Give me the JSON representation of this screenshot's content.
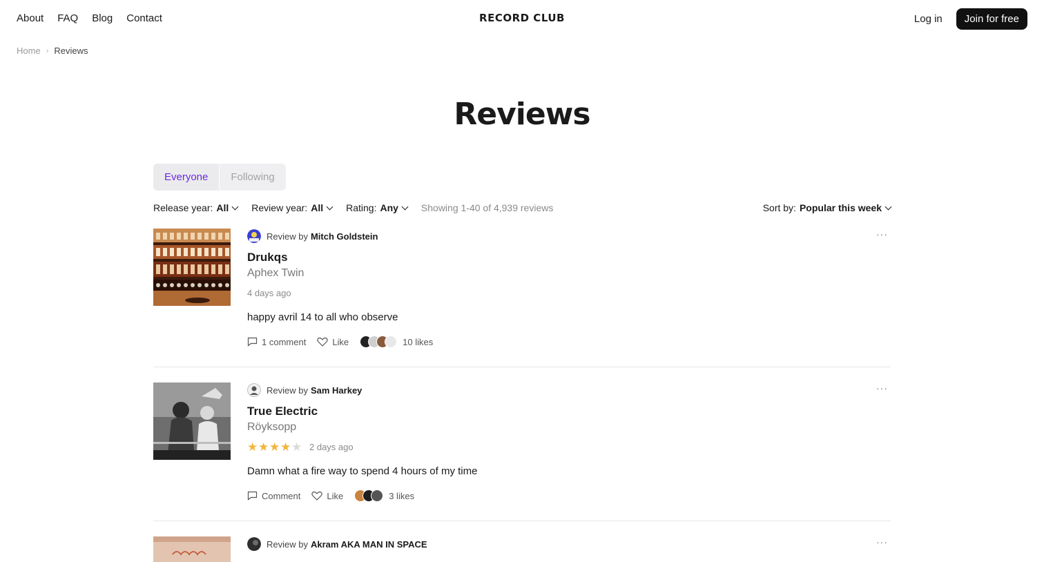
{
  "nav": {
    "links": [
      "About",
      "FAQ",
      "Blog",
      "Contact"
    ],
    "logo": "RECORD CLUB",
    "login": "Log in",
    "join": "Join for free"
  },
  "breadcrumb": {
    "home": "Home",
    "current": "Reviews",
    "separator": "›"
  },
  "page": {
    "title": "Reviews"
  },
  "tabs": {
    "everyone": "Everyone",
    "following": "Following"
  },
  "filters": {
    "release_year": {
      "label": "Release year:",
      "value": "All"
    },
    "review_year": {
      "label": "Review year:",
      "value": "All"
    },
    "rating": {
      "label": "Rating:",
      "value": "Any"
    },
    "showing": "Showing 1-40 of 4,939 reviews"
  },
  "sort": {
    "label": "Sort by:",
    "value": "Popular this week"
  },
  "reviews": [
    {
      "prefix": "Review by",
      "user": "Mitch Goldstein",
      "album": "Drukqs",
      "artist": "Aphex Twin",
      "rating": null,
      "time": "4 days ago",
      "text": "happy avril 14 to all who observe",
      "comments": "1 comment",
      "like": "Like",
      "likes": "10 likes",
      "more": "···"
    },
    {
      "prefix": "Review by",
      "user": "Sam Harkey",
      "album": "True Electric",
      "artist": "Röyksopp",
      "rating": 4,
      "time": "2 days ago",
      "text": "Damn what a fire way to spend 4 hours of my time",
      "comments": "Comment",
      "like": "Like",
      "likes": "3 likes",
      "more": "···"
    },
    {
      "prefix": "Review by",
      "user": "Akram AKA MAN IN SPACE",
      "more": "···"
    }
  ],
  "colors": {
    "accent": "#6a2bd9",
    "star": "#f2b53a",
    "button": "#111111"
  }
}
